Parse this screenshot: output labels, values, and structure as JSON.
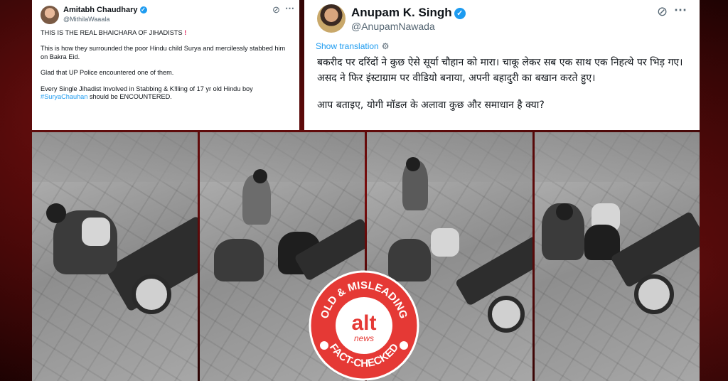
{
  "left_tweet": {
    "name": "Amitabh Chaudhary",
    "handle": "@MithilaWaaala",
    "line1": "THIS IS THE REAL BHAICHARA OF JIHADISTS",
    "line1_mark": "!",
    "para2": "This is how they surrounded the poor Hindu child Surya and mercilessly stabbed him on Bakra Eid.",
    "para3": "Glad that UP Police encountered one of them.",
    "para4_start": "Every Single Jihadist Involved in Stabbing & K!lling of 17 yr old Hindu boy",
    "hashtag": "#SuryaChauhan",
    "para4_end": " should be ENCOUNTERED."
  },
  "right_tweet": {
    "name": "Anupam K. Singh",
    "handle": "@AnupamNawada",
    "show_translation": "Show translation",
    "para1": "बकरीद पर दरिंदों ने कुछ ऐसे सूर्या चौहान को मारा। चाकू लेकर सब एक साथ एक निहत्थे पर भिड़ गए। असद ने फिर इंस्टाग्राम पर वीडियो बनाया, अपनी बहादुरी का बखान करते हुए।",
    "para2": "आप बताइए, योगी मॉडल के अलावा कुछ और समाधान है क्या?"
  },
  "icons": {
    "verified": "verified-badge-icon",
    "grok": "grok-icon",
    "more": "more-options-icon",
    "globe": "globe-icon"
  },
  "badge": {
    "top_text": "OLD & MISLEADING",
    "bottom_text": "FACT-CHECKED",
    "logo_alt": "alt",
    "logo_news": "news"
  },
  "colors": {
    "badge_red": "#e53935",
    "link_blue": "#1d9bf0",
    "background_red": "#5a0808"
  }
}
